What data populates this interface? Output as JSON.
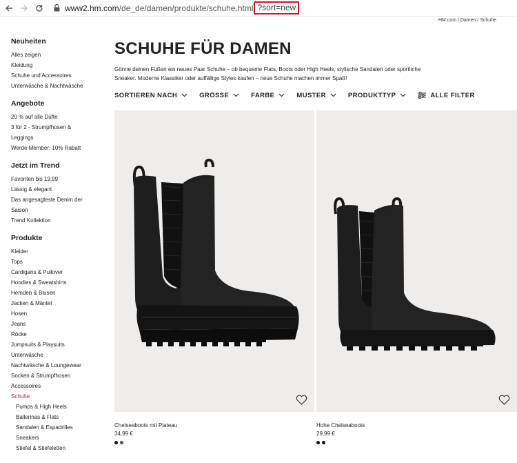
{
  "browser": {
    "url_host": "www2.hm.com",
    "url_path": "/de_de/damen/produkte/schuhe.html",
    "url_param": "?sort=new",
    "back_icon": "arrow-left-icon",
    "forward_icon": "arrow-right-icon",
    "reload_icon": "reload-icon",
    "lock_icon": "lock-icon"
  },
  "breadcrumb": "HM.com / Damen / Schuhe",
  "sidebar": {
    "groups": [
      {
        "heading": "Neuheiten",
        "items": [
          "Alles zeigen",
          "Kleidung",
          "Schuhe und Accessoires",
          "Unterwäsche & Nachtwäsche"
        ]
      },
      {
        "heading": "Angebote",
        "items": [
          "20 % auf alle Düfte",
          "3 für 2 - Strumpfhosen &",
          "Leggings",
          "Werde Member: 10% Rabatt"
        ]
      },
      {
        "heading": "Jetzt im Trend",
        "items": [
          "Favoriten bis 19,99",
          "Lässig & elegant",
          "Das angesagteste Denim der",
          "Saison",
          "Trend Kollektion"
        ]
      },
      {
        "heading": "Produkte",
        "items": [
          "Kleider",
          "Tops",
          "Cardigans & Pullover",
          "Hoodies & Sweatshirts",
          "Hemden & Blusen",
          "Jacken & Mäntel",
          "Hosen",
          "Jeans",
          "Röcke",
          "Jumpsuits & Playsuits",
          "Unterwäsche",
          "Nachtwäsche & Loungewear",
          "Socken & Strumpfhosen",
          "Accessoires",
          "Schuhe",
          "Pumps & High Heels",
          "Ballerinas & Flats",
          "Sandalen & Espadrilles",
          "Sneakers",
          "Stiefel & Stiefeletten"
        ]
      }
    ]
  },
  "main": {
    "title": "SCHUHE FÜR DAMEN",
    "intro": "Gönne deinen Füßen ein neues Paar Schuhe – ob bequeme Flats, Boots oder High Heels, stylische Sandalen oder sportliche Sneaker. Moderne Klassiker oder auffällige Styles kaufen – neue Schuhe machen immer Spaß!",
    "filters": [
      "SORTIEREN NACH",
      "GRÖSSE",
      "FARBE",
      "MUSTER",
      "PRODUKTTYP"
    ],
    "all_filters": "ALLE FILTER"
  },
  "products": [
    {
      "name": "Chelseaboots mit Plateau",
      "price": "34,99 €",
      "swatches": [
        "#111111",
        "#6b4a32"
      ],
      "icon": "heart-icon"
    },
    {
      "name": "Hohe Chelseaboots",
      "price": "29,99 €",
      "swatches": [
        "#111111",
        "#111111"
      ],
      "icon": "heart-icon"
    }
  ],
  "colors": {
    "accent_red": "#d0181b",
    "photo_bg": "#eeedeb"
  }
}
